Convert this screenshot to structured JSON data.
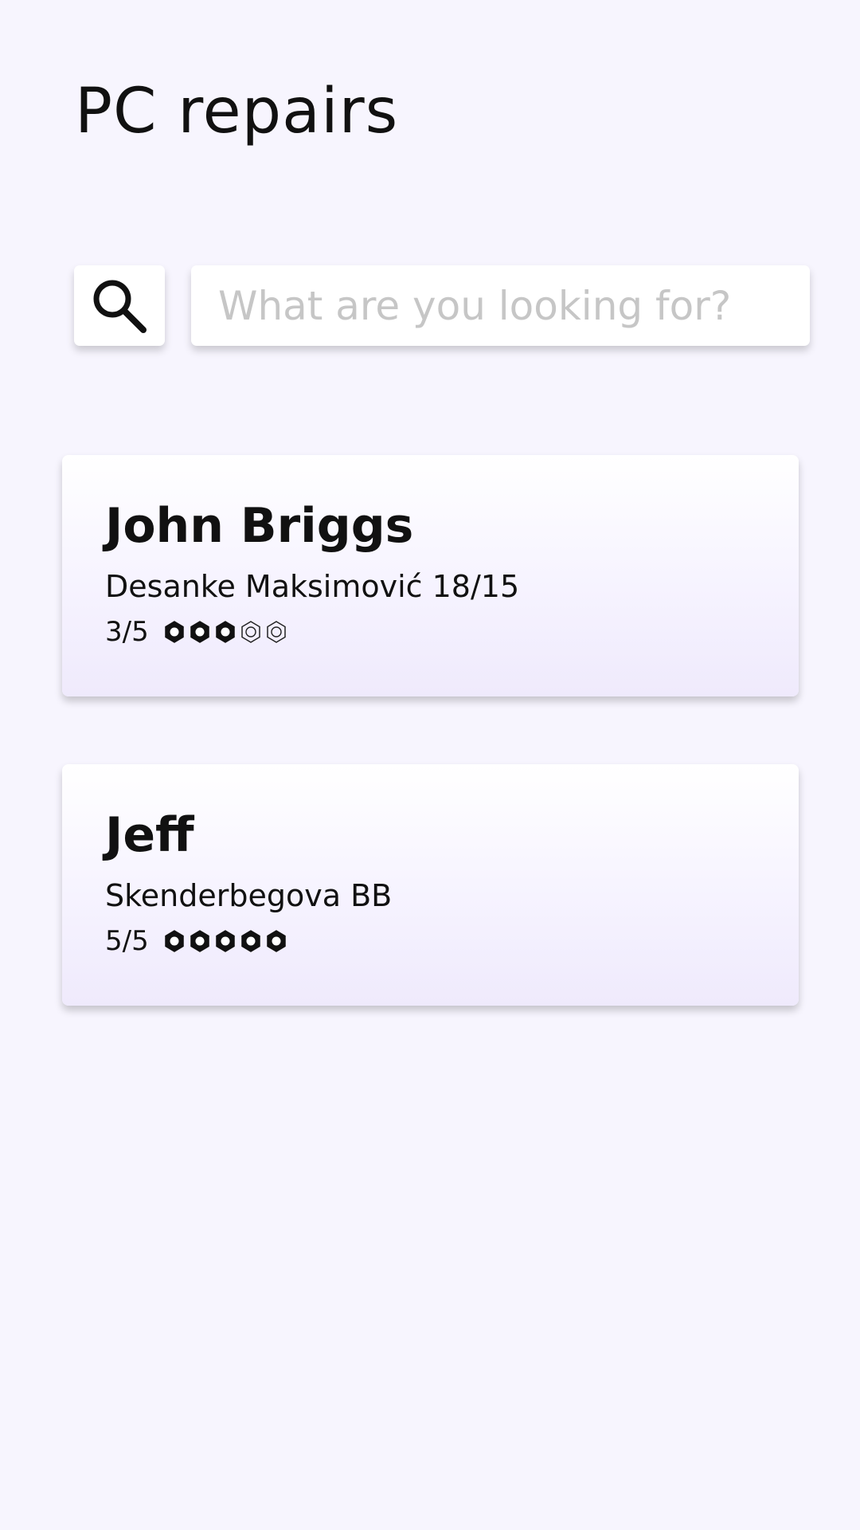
{
  "header": {
    "title": "PC repairs"
  },
  "search": {
    "button_icon": "search-icon",
    "placeholder": "What are you looking for?",
    "value": ""
  },
  "results": [
    {
      "name": "John Briggs",
      "address": "Desanke Maksimović 18/15",
      "rating_label": "3/5",
      "rating_value": 3,
      "rating_max": 5,
      "rating_icon": "hex-nut-icon"
    },
    {
      "name": "Jeff",
      "address": "Skenderbegova BB",
      "rating_label": "5/5",
      "rating_value": 5,
      "rating_max": 5,
      "rating_icon": "hex-nut-icon"
    }
  ],
  "colors": {
    "background": "#f7f5fe",
    "card_top": "#ffffff",
    "card_bottom": "#efeafc",
    "text": "#111111",
    "placeholder": "#c6c6c6"
  }
}
